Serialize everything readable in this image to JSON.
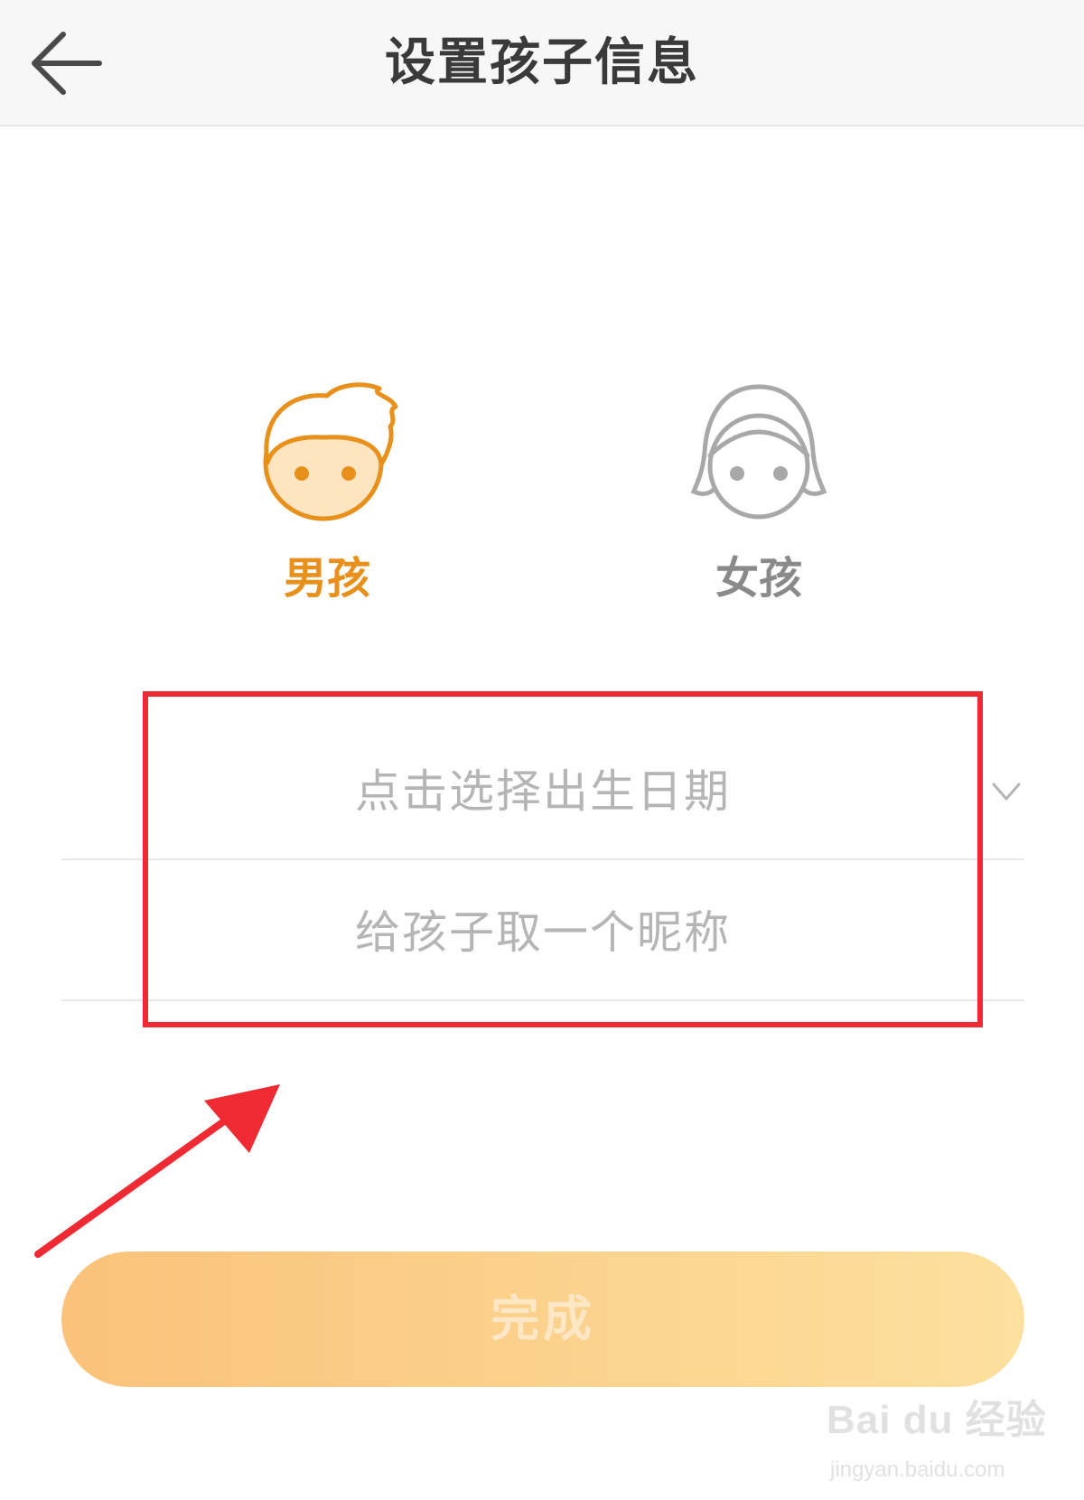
{
  "header": {
    "back_icon": "arrow-left-icon",
    "title": "设置孩子信息"
  },
  "gender": {
    "selected": "boy",
    "options": [
      {
        "id": "boy",
        "label": "男孩",
        "icon": "boy-face-icon",
        "color": "#e8901c"
      },
      {
        "id": "girl",
        "label": "女孩",
        "icon": "girl-face-icon",
        "color": "#a8a8a8"
      }
    ]
  },
  "form": {
    "birthdate_placeholder": "点击选择出生日期",
    "birthdate_icon": "chevron-down-icon",
    "nickname_placeholder": "给孩子取一个昵称",
    "nickname_value": ""
  },
  "actions": {
    "done_label": "完成",
    "done_gradient": [
      "#fac27a",
      "#fde09e"
    ]
  },
  "annotation": {
    "highlight_color": "#f02a32"
  },
  "watermark": {
    "logo": "Bai du 经验",
    "url": "jingyan.baidu.com"
  }
}
